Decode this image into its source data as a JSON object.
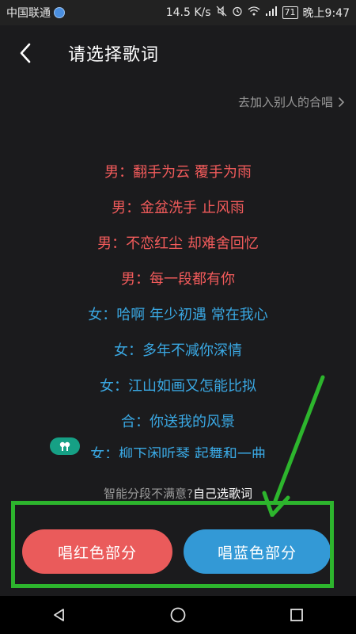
{
  "status_bar": {
    "carrier": "中国联通",
    "speed": "14.5 K/s",
    "battery": "71",
    "time": "晚上9:47"
  },
  "header": {
    "title": "请选择歌词",
    "join_link": "去加入别人的合唱"
  },
  "lyrics": [
    {
      "role": "male",
      "text": "男：翻手为云 覆手为雨"
    },
    {
      "role": "male",
      "text": "男：金盆洗手 止风雨"
    },
    {
      "role": "male",
      "text": "男：不恋红尘 却难舍回忆"
    },
    {
      "role": "male",
      "text": "男：每一段都有你"
    },
    {
      "role": "female",
      "text": "女：哈啊 年少初遇 常在我心"
    },
    {
      "role": "female",
      "text": "女：多年不减你深情"
    },
    {
      "role": "female",
      "text": "女：江山如画又怎能比拟"
    },
    {
      "role": "chorus",
      "text": "合：你送我的风景"
    },
    {
      "role": "female",
      "text": "女：柳下闲听琴 起舞和一曲"
    }
  ],
  "hint": {
    "prefix": "智能分段不满意?",
    "link": "自己选歌词"
  },
  "buttons": {
    "red": "唱红色部分",
    "blue": "唱蓝色部分"
  },
  "colors": {
    "male": "#f25b5b",
    "female": "#3aa8e3",
    "button_red": "#ea5b5b",
    "button_blue": "#3399d6",
    "annotation": "#2db52d"
  },
  "icons": {
    "back": "chevron-left-icon",
    "join": "chevron-right-icon",
    "chorus_badge": "chorus-badge-icon",
    "nav_back": "nav-back-icon",
    "nav_home": "nav-home-icon",
    "nav_recent": "nav-recent-icon"
  }
}
